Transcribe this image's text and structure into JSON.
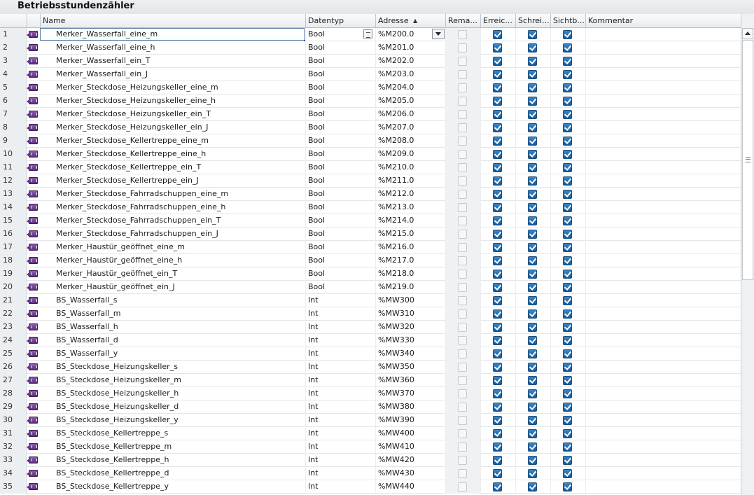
{
  "editor": {
    "title": "Betriebsstundenzähler"
  },
  "columns": {
    "name": "Name",
    "datatype": "Datentyp",
    "address": "Adresse",
    "remanent": "Rema...",
    "reachable": "Erreic...",
    "writable": "Schrei...",
    "visible": "Sichtb...",
    "comment": "Kommentar"
  },
  "sort": {
    "column": "address",
    "direction": "ascending"
  },
  "tag_icon": "plc-tag-icon",
  "selected_row": 1,
  "rows": [
    {
      "num": "1",
      "name": "Merker_Wasserfall_eine_m",
      "type": "Bool",
      "addr": "%M200.0",
      "rem": false,
      "reach": true,
      "write": true,
      "visible": true
    },
    {
      "num": "2",
      "name": "Merker_Wasserfall_eine_h",
      "type": "Bool",
      "addr": "%M201.0",
      "rem": false,
      "reach": true,
      "write": true,
      "visible": true
    },
    {
      "num": "3",
      "name": "Merker_Wasserfall_ein_T",
      "type": "Bool",
      "addr": "%M202.0",
      "rem": false,
      "reach": true,
      "write": true,
      "visible": true
    },
    {
      "num": "4",
      "name": "Merker_Wasserfall_ein_J",
      "type": "Bool",
      "addr": "%M203.0",
      "rem": false,
      "reach": true,
      "write": true,
      "visible": true
    },
    {
      "num": "5",
      "name": "Merker_Steckdose_Heizungskeller_eine_m",
      "type": "Bool",
      "addr": "%M204.0",
      "rem": false,
      "reach": true,
      "write": true,
      "visible": true
    },
    {
      "num": "6",
      "name": "Merker_Steckdose_Heizungskeller_eine_h",
      "type": "Bool",
      "addr": "%M205.0",
      "rem": false,
      "reach": true,
      "write": true,
      "visible": true
    },
    {
      "num": "7",
      "name": "Merker_Steckdose_Heizungskeller_ein_T",
      "type": "Bool",
      "addr": "%M206.0",
      "rem": false,
      "reach": true,
      "write": true,
      "visible": true
    },
    {
      "num": "8",
      "name": "Merker_Steckdose_Heizungskeller_ein_J",
      "type": "Bool",
      "addr": "%M207.0",
      "rem": false,
      "reach": true,
      "write": true,
      "visible": true
    },
    {
      "num": "9",
      "name": "Merker_Steckdose_Kellertreppe_eine_m",
      "type": "Bool",
      "addr": "%M208.0",
      "rem": false,
      "reach": true,
      "write": true,
      "visible": true
    },
    {
      "num": "10",
      "name": "Merker_Steckdose_Kellertreppe_eine_h",
      "type": "Bool",
      "addr": "%M209.0",
      "rem": false,
      "reach": true,
      "write": true,
      "visible": true
    },
    {
      "num": "11",
      "name": "Merker_Steckdose_Kellertreppe_ein_T",
      "type": "Bool",
      "addr": "%M210.0",
      "rem": false,
      "reach": true,
      "write": true,
      "visible": true
    },
    {
      "num": "12",
      "name": "Merker_Steckdose_Kellertreppe_ein_J",
      "type": "Bool",
      "addr": "%M211.0",
      "rem": false,
      "reach": true,
      "write": true,
      "visible": true
    },
    {
      "num": "13",
      "name": "Merker_Steckdose_Fahrradschuppen_eine_m",
      "type": "Bool",
      "addr": "%M212.0",
      "rem": false,
      "reach": true,
      "write": true,
      "visible": true
    },
    {
      "num": "14",
      "name": "Merker_Steckdose_Fahrradschuppen_eine_h",
      "type": "Bool",
      "addr": "%M213.0",
      "rem": false,
      "reach": true,
      "write": true,
      "visible": true
    },
    {
      "num": "15",
      "name": "Merker_Steckdose_Fahrradschuppen_ein_T",
      "type": "Bool",
      "addr": "%M214.0",
      "rem": false,
      "reach": true,
      "write": true,
      "visible": true
    },
    {
      "num": "16",
      "name": "Merker_Steckdose_Fahrradschuppen_ein_J",
      "type": "Bool",
      "addr": "%M215.0",
      "rem": false,
      "reach": true,
      "write": true,
      "visible": true
    },
    {
      "num": "17",
      "name": "Merker_Haustür_geöffnet_eine_m",
      "type": "Bool",
      "addr": "%M216.0",
      "rem": false,
      "reach": true,
      "write": true,
      "visible": true
    },
    {
      "num": "18",
      "name": "Merker_Haustür_geöffnet_eine_h",
      "type": "Bool",
      "addr": "%M217.0",
      "rem": false,
      "reach": true,
      "write": true,
      "visible": true
    },
    {
      "num": "19",
      "name": "Merker_Haustür_geöffnet_ein_T",
      "type": "Bool",
      "addr": "%M218.0",
      "rem": false,
      "reach": true,
      "write": true,
      "visible": true
    },
    {
      "num": "20",
      "name": "Merker_Haustür_geöffnet_ein_J",
      "type": "Bool",
      "addr": "%M219.0",
      "rem": false,
      "reach": true,
      "write": true,
      "visible": true
    },
    {
      "num": "21",
      "name": "BS_Wasserfall_s",
      "type": "Int",
      "addr": "%MW300",
      "rem": false,
      "reach": true,
      "write": true,
      "visible": true
    },
    {
      "num": "22",
      "name": "BS_Wasserfall_m",
      "type": "Int",
      "addr": "%MW310",
      "rem": false,
      "reach": true,
      "write": true,
      "visible": true
    },
    {
      "num": "23",
      "name": "BS_Wasserfall_h",
      "type": "Int",
      "addr": "%MW320",
      "rem": false,
      "reach": true,
      "write": true,
      "visible": true
    },
    {
      "num": "24",
      "name": "BS_Wasserfall_d",
      "type": "Int",
      "addr": "%MW330",
      "rem": false,
      "reach": true,
      "write": true,
      "visible": true
    },
    {
      "num": "25",
      "name": "BS_Wasserfall_y",
      "type": "Int",
      "addr": "%MW340",
      "rem": false,
      "reach": true,
      "write": true,
      "visible": true
    },
    {
      "num": "26",
      "name": "BS_Steckdose_Heizungskeller_s",
      "type": "Int",
      "addr": "%MW350",
      "rem": false,
      "reach": true,
      "write": true,
      "visible": true
    },
    {
      "num": "27",
      "name": "BS_Steckdose_Heizungskeller_m",
      "type": "Int",
      "addr": "%MW360",
      "rem": false,
      "reach": true,
      "write": true,
      "visible": true
    },
    {
      "num": "28",
      "name": "BS_Steckdose_Heizungskeller_h",
      "type": "Int",
      "addr": "%MW370",
      "rem": false,
      "reach": true,
      "write": true,
      "visible": true
    },
    {
      "num": "29",
      "name": "BS_Steckdose_Heizungskeller_d",
      "type": "Int",
      "addr": "%MW380",
      "rem": false,
      "reach": true,
      "write": true,
      "visible": true
    },
    {
      "num": "30",
      "name": "BS_Steckdose_Heizungskeller_y",
      "type": "Int",
      "addr": "%MW390",
      "rem": false,
      "reach": true,
      "write": true,
      "visible": true
    },
    {
      "num": "31",
      "name": "BS_Steckdose_Kellertreppe_s",
      "type": "Int",
      "addr": "%MW400",
      "rem": false,
      "reach": true,
      "write": true,
      "visible": true
    },
    {
      "num": "32",
      "name": "BS_Steckdose_Kellertreppe_m",
      "type": "Int",
      "addr": "%MW410",
      "rem": false,
      "reach": true,
      "write": true,
      "visible": true
    },
    {
      "num": "33",
      "name": "BS_Steckdose_Kellertreppe_h",
      "type": "Int",
      "addr": "%MW420",
      "rem": false,
      "reach": true,
      "write": true,
      "visible": true
    },
    {
      "num": "34",
      "name": "BS_Steckdose_Kellertreppe_d",
      "type": "Int",
      "addr": "%MW430",
      "rem": false,
      "reach": true,
      "write": true,
      "visible": true
    },
    {
      "num": "35",
      "name": "BS_Steckdose_Kellertreppe_y",
      "type": "Int",
      "addr": "%MW440",
      "rem": false,
      "reach": true,
      "write": true,
      "visible": true
    }
  ]
}
